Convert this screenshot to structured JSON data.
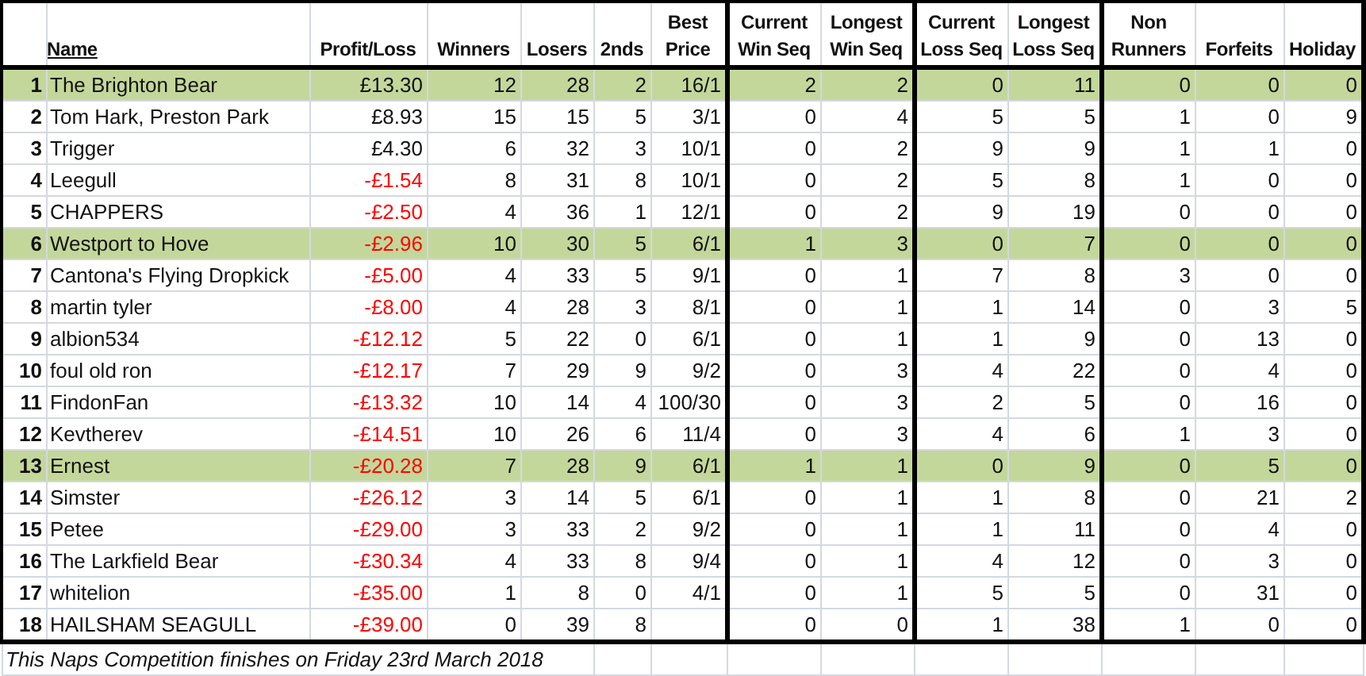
{
  "columns": [
    {
      "lines": [
        "Name"
      ],
      "kind": "name"
    },
    {
      "lines": [
        "Profit/Loss"
      ],
      "kind": "num"
    },
    {
      "lines": [
        "Winners"
      ],
      "kind": "num"
    },
    {
      "lines": [
        "Losers"
      ],
      "kind": "num"
    },
    {
      "lines": [
        "2nds"
      ],
      "kind": "num"
    },
    {
      "lines": [
        "Best",
        "Price"
      ],
      "kind": "num"
    },
    {
      "lines": [
        "Current",
        "Win Seq"
      ],
      "kind": "num"
    },
    {
      "lines": [
        "Longest",
        "Win Seq"
      ],
      "kind": "num"
    },
    {
      "lines": [
        "Current",
        "Loss Seq"
      ],
      "kind": "num"
    },
    {
      "lines": [
        "Longest",
        "Loss Seq"
      ],
      "kind": "num"
    },
    {
      "lines": [
        "Non",
        "Runners"
      ],
      "kind": "num"
    },
    {
      "lines": [
        "Forfeits"
      ],
      "kind": "num"
    },
    {
      "lines": [
        "Holiday"
      ],
      "kind": "num"
    }
  ],
  "rows": [
    {
      "rank": "1",
      "highlighted": true,
      "negative": false,
      "cells": [
        "The Brighton Bear",
        "£13.30",
        "12",
        "28",
        "2",
        "16/1",
        "2",
        "2",
        "0",
        "11",
        "0",
        "0",
        "0"
      ]
    },
    {
      "rank": "2",
      "highlighted": false,
      "negative": false,
      "cells": [
        "Tom Hark, Preston Park",
        "£8.93",
        "15",
        "15",
        "5",
        "3/1",
        "0",
        "4",
        "5",
        "5",
        "1",
        "0",
        "9"
      ]
    },
    {
      "rank": "3",
      "highlighted": false,
      "negative": false,
      "cells": [
        "Trigger",
        "£4.30",
        "6",
        "32",
        "3",
        "10/1",
        "0",
        "2",
        "9",
        "9",
        "1",
        "1",
        "0"
      ]
    },
    {
      "rank": "4",
      "highlighted": false,
      "negative": true,
      "cells": [
        "Leegull",
        "-£1.54",
        "8",
        "31",
        "8",
        "10/1",
        "0",
        "2",
        "5",
        "8",
        "1",
        "0",
        "0"
      ]
    },
    {
      "rank": "5",
      "highlighted": false,
      "negative": true,
      "cells": [
        "CHAPPERS",
        "-£2.50",
        "4",
        "36",
        "1",
        "12/1",
        "0",
        "2",
        "9",
        "19",
        "0",
        "0",
        "0"
      ]
    },
    {
      "rank": "6",
      "highlighted": true,
      "negative": true,
      "cells": [
        "Westport to Hove",
        "-£2.96",
        "10",
        "30",
        "5",
        "6/1",
        "1",
        "3",
        "0",
        "7",
        "0",
        "0",
        "0"
      ]
    },
    {
      "rank": "7",
      "highlighted": false,
      "negative": true,
      "cells": [
        "Cantona's Flying Dropkick",
        "-£5.00",
        "4",
        "33",
        "5",
        "9/1",
        "0",
        "1",
        "7",
        "8",
        "3",
        "0",
        "0"
      ]
    },
    {
      "rank": "8",
      "highlighted": false,
      "negative": true,
      "cells": [
        "martin tyler",
        "-£8.00",
        "4",
        "28",
        "3",
        "8/1",
        "0",
        "1",
        "1",
        "14",
        "0",
        "3",
        "5"
      ]
    },
    {
      "rank": "9",
      "highlighted": false,
      "negative": true,
      "cells": [
        "albion534",
        "-£12.12",
        "5",
        "22",
        "0",
        "6/1",
        "0",
        "1",
        "1",
        "9",
        "0",
        "13",
        "0"
      ]
    },
    {
      "rank": "10",
      "highlighted": false,
      "negative": true,
      "cells": [
        "foul old ron",
        "-£12.17",
        "7",
        "29",
        "9",
        "9/2",
        "0",
        "3",
        "4",
        "22",
        "0",
        "4",
        "0"
      ]
    },
    {
      "rank": "11",
      "highlighted": false,
      "negative": true,
      "cells": [
        "FindonFan",
        "-£13.32",
        "10",
        "14",
        "4",
        "100/30",
        "0",
        "3",
        "2",
        "5",
        "0",
        "16",
        "0"
      ]
    },
    {
      "rank": "12",
      "highlighted": false,
      "negative": true,
      "cells": [
        "Kevtherev",
        "-£14.51",
        "10",
        "26",
        "6",
        "11/4",
        "0",
        "3",
        "4",
        "6",
        "1",
        "3",
        "0"
      ]
    },
    {
      "rank": "13",
      "highlighted": true,
      "negative": true,
      "cells": [
        "Ernest",
        "-£20.28",
        "7",
        "28",
        "9",
        "6/1",
        "1",
        "1",
        "0",
        "9",
        "0",
        "5",
        "0"
      ]
    },
    {
      "rank": "14",
      "highlighted": false,
      "negative": true,
      "cells": [
        "Simster",
        "-£26.12",
        "3",
        "14",
        "5",
        "6/1",
        "0",
        "1",
        "1",
        "8",
        "0",
        "21",
        "2"
      ]
    },
    {
      "rank": "15",
      "highlighted": false,
      "negative": true,
      "cells": [
        "Petee",
        "-£29.00",
        "3",
        "33",
        "2",
        "9/2",
        "0",
        "1",
        "1",
        "11",
        "0",
        "4",
        "0"
      ]
    },
    {
      "rank": "16",
      "highlighted": false,
      "negative": true,
      "cells": [
        "The Larkfield Bear",
        "-£30.34",
        "4",
        "33",
        "8",
        "9/4",
        "0",
        "1",
        "4",
        "12",
        "0",
        "3",
        "0"
      ]
    },
    {
      "rank": "17",
      "highlighted": false,
      "negative": true,
      "cells": [
        "whitelion",
        "-£35.00",
        "1",
        "8",
        "0",
        "4/1",
        "0",
        "1",
        "5",
        "5",
        "0",
        "31",
        "0"
      ]
    },
    {
      "rank": "18",
      "highlighted": false,
      "negative": true,
      "cells": [
        "HAILSHAM SEAGULL",
        "-£39.00",
        "0",
        "39",
        "8",
        "",
        "0",
        "0",
        "1",
        "38",
        "1",
        "0",
        "0"
      ]
    }
  ],
  "footer": "This Naps Competition finishes on Friday 23rd March 2018"
}
